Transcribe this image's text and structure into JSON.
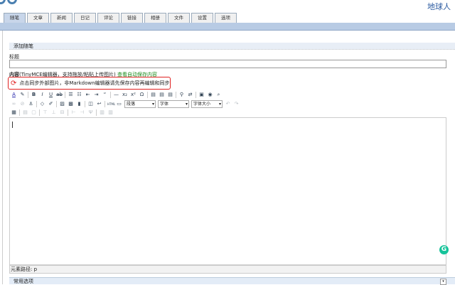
{
  "header": {
    "user": "地球人"
  },
  "tabs": [
    "随笔",
    "文章",
    "新闻",
    "日记",
    "评论",
    "链接",
    "相册",
    "文件",
    "设置",
    "选项"
  ],
  "active_tab": 0,
  "section_title": "添加随笔",
  "title_label": "标题",
  "title_value": "",
  "content_label": "内容",
  "content_hint": "(TinyMCE编辑器，支持拖放/粘贴上传图片)",
  "autosave_link": "查看自动保存内容",
  "notice": "点击同步外部图片，非Markdown编辑器请先保存内容再编辑和同步",
  "toolbar": {
    "format_select": "段落",
    "font_select": "字体",
    "size_select": "字体大小"
  },
  "status_path": "元素路径: p",
  "common_options": "常用选项",
  "colors": {
    "accent": "#b8cbe4",
    "notice_border": "#e02020",
    "link": "#1a8a1a"
  }
}
